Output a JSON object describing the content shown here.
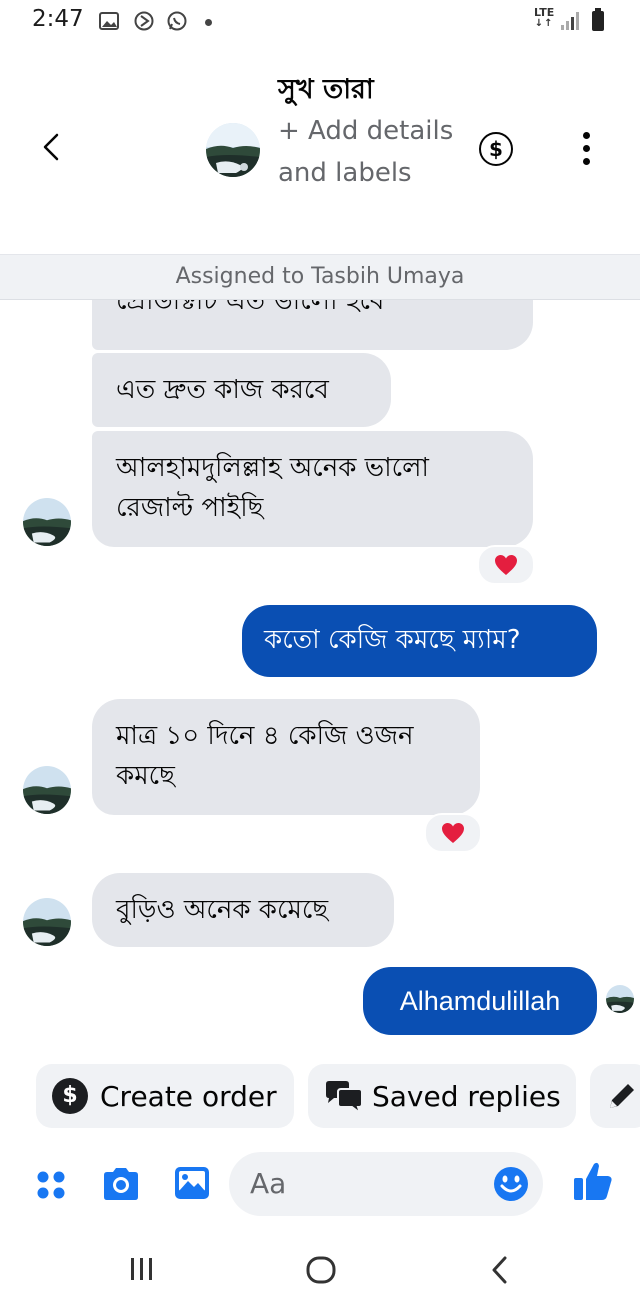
{
  "status_bar": {
    "time": "2:47",
    "network": "LTE",
    "icons": [
      "gallery-notification-icon",
      "data-saver-icon",
      "whatsapp-icon",
      "notification-dot",
      "signal-icon",
      "battery-icon"
    ]
  },
  "header": {
    "thread_name": "সুখ তারা",
    "add_details": "+ Add details and labels",
    "icons": [
      "back-chevron-icon",
      "avatar",
      "dollar-icon",
      "more-vertical-icon"
    ]
  },
  "assigned_banner": "Assigned to Tasbih Umaya",
  "messages": [
    {
      "direction": "incoming",
      "text": "প্রোডাক্টটি এত ভালো হবে"
    },
    {
      "direction": "incoming",
      "text": "এত দ্রুত কাজ করবে"
    },
    {
      "direction": "incoming",
      "text": "আলহামদুলিল্লাহ অনেক ভালো রেজাল্ট পাইছি",
      "reaction": "heart"
    },
    {
      "direction": "outgoing",
      "text": "কতো কেজি কমছে ম্যাম?"
    },
    {
      "direction": "incoming",
      "text": "মাত্র ১০ দিনে ৪ কেজি ওজন কমছে",
      "reaction": "heart"
    },
    {
      "direction": "incoming",
      "text": "বুড়িও অনেক কমেছে"
    },
    {
      "direction": "outgoing",
      "text": "Alhamdulillah",
      "seen": true
    }
  ],
  "quick_replies": {
    "create_order": "Create order",
    "saved_replies": "Saved replies"
  },
  "composer": {
    "placeholder": "Aa"
  },
  "colors": {
    "accent": "#0a4fb3",
    "messenger_blue": "#1877f2",
    "incoming_bubble": "#e4e6eb",
    "reaction_heart": "#e41e3f"
  }
}
